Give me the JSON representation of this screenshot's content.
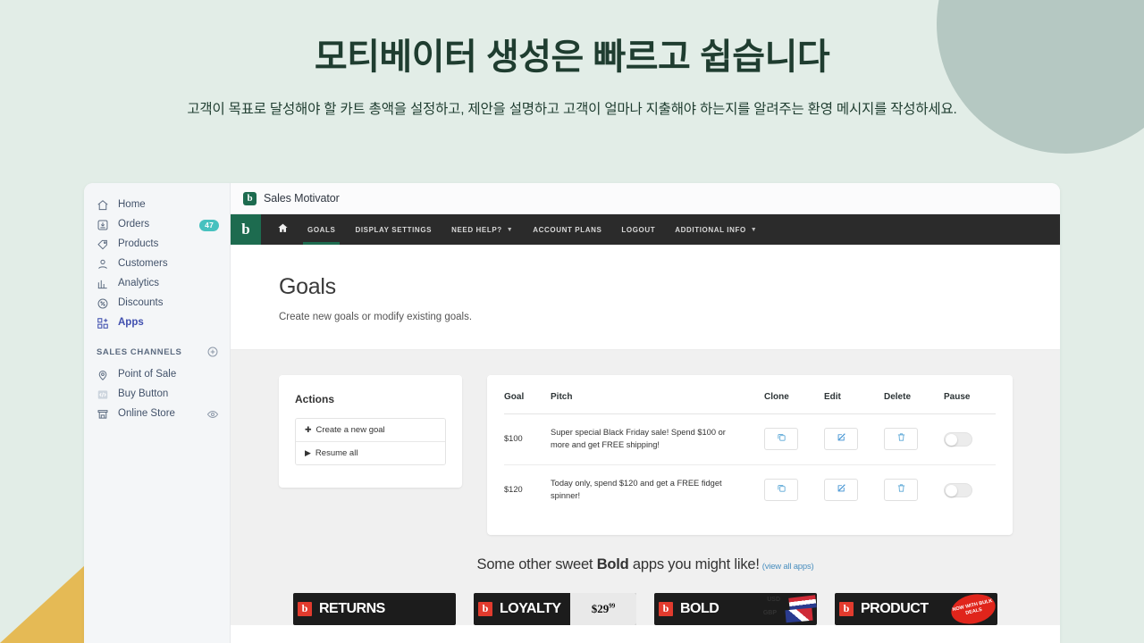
{
  "hero": {
    "title": "모티베이터 생성은 빠르고 쉽습니다",
    "subtitle": "고객이 목표로 달성해야 할 카트 총액을 설정하고, 제안을 설명하고 고객이 얼마나 지출해야 하는지를 알려주는 환영 메시지를 작성하세요."
  },
  "sidebar": {
    "items": [
      {
        "label": "Home",
        "icon": "home-icon",
        "badge": null
      },
      {
        "label": "Orders",
        "icon": "orders-icon",
        "badge": "47"
      },
      {
        "label": "Products",
        "icon": "products-tag-icon",
        "badge": null
      },
      {
        "label": "Customers",
        "icon": "customers-icon",
        "badge": null
      },
      {
        "label": "Analytics",
        "icon": "analytics-bars-icon",
        "badge": null
      },
      {
        "label": "Discounts",
        "icon": "discounts-percent-icon",
        "badge": null
      },
      {
        "label": "Apps",
        "icon": "apps-grid-plus-icon",
        "badge": null
      }
    ],
    "section_title": "SALES CHANNELS",
    "channels": [
      {
        "label": "Point of Sale",
        "icon": "location-pin-icon",
        "trailing": null
      },
      {
        "label": "Buy Button",
        "icon": "code-brackets-icon",
        "trailing": null
      },
      {
        "label": "Online Store",
        "icon": "storefront-icon",
        "trailing": "eye-icon"
      }
    ]
  },
  "app": {
    "titlebar": {
      "logo_letter": "b",
      "title": "Sales Motivator"
    },
    "topnav": {
      "brand_letter": "b",
      "items": [
        {
          "label": "",
          "icon": "home-solid-icon",
          "caret": false,
          "active": false
        },
        {
          "label": "GOALS",
          "caret": false,
          "active": true
        },
        {
          "label": "DISPLAY SETTINGS",
          "caret": false,
          "active": false
        },
        {
          "label": "NEED HELP?",
          "caret": true,
          "active": false
        },
        {
          "label": "ACCOUNT PLANS",
          "caret": false,
          "active": false
        },
        {
          "label": "LOGOUT",
          "caret": false,
          "active": false
        },
        {
          "label": "ADDITIONAL INFO",
          "caret": true,
          "active": false
        }
      ]
    },
    "page": {
      "title": "Goals",
      "subtitle": "Create new goals or modify existing goals."
    },
    "actions": {
      "title": "Actions",
      "items": [
        {
          "glyph": "✚",
          "label": "Create a new goal"
        },
        {
          "glyph": "▶",
          "label": "Resume all"
        }
      ]
    },
    "table": {
      "columns": [
        "Goal",
        "Pitch",
        "Clone",
        "Edit",
        "Delete",
        "Pause"
      ],
      "rows": [
        {
          "goal": "$100",
          "pitch": "Super special Black Friday sale! Spend $100 or more and get FREE shipping!",
          "paused": false
        },
        {
          "goal": "$120",
          "pitch": "Today only, spend $120 and get a FREE fidget spinner!",
          "paused": false
        }
      ]
    },
    "promo": {
      "heading_pre": "Some other sweet ",
      "heading_bold": "Bold",
      "heading_post": " apps you might like!",
      "link": "(view all apps)",
      "cards": [
        {
          "word": "RETURNS",
          "art": "box",
          "price": "",
          "badge": ""
        },
        {
          "word": "LOYALTY",
          "art": "price",
          "price": "29",
          "cents": "99",
          "badge": ""
        },
        {
          "word": "BOLD",
          "art": "flags",
          "currency1": "USD",
          "currency2": "GBP",
          "badge": ""
        },
        {
          "word": "PRODUCT",
          "art": "badge",
          "badge": "NOW WITH BULK DEALS"
        }
      ]
    }
  },
  "colors": {
    "page_bg": "#e2ede7",
    "deco_circle": "#b5c8c2",
    "deco_triangle": "#e5ba55",
    "brand_green": "#1d6b4f",
    "nav_dark": "#2b2b2b",
    "badge_teal": "#47c1bf",
    "accent_blue": "#3f4eae",
    "link_blue": "#4a8fbf",
    "hero_text": "#1f3d30"
  }
}
